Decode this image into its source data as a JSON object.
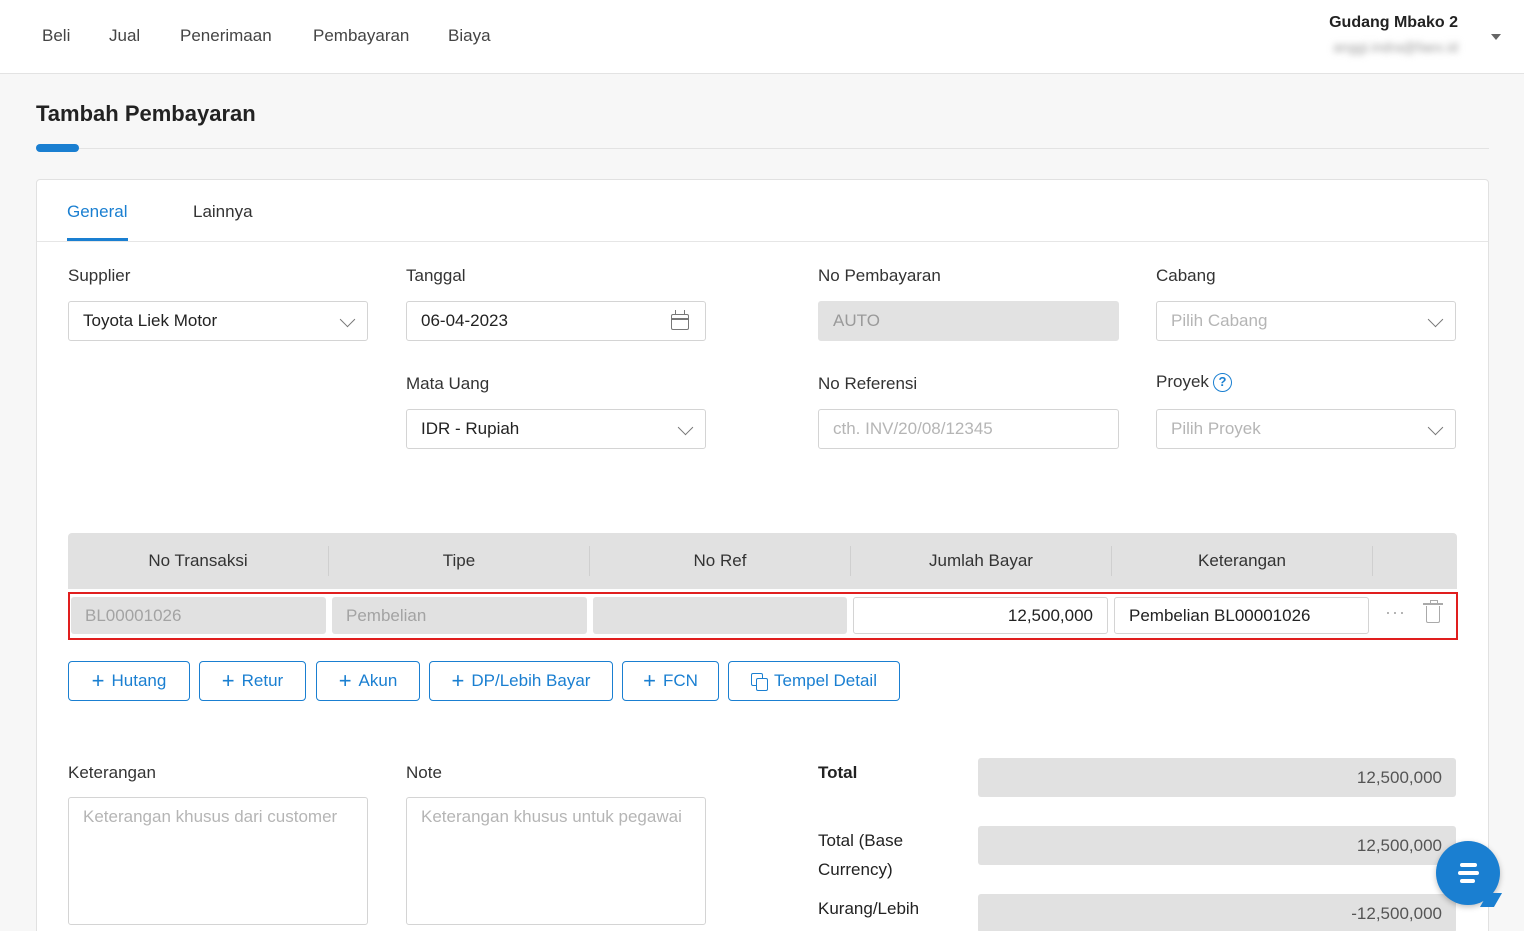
{
  "nav": [
    "Beli",
    "Jual",
    "Penerimaan",
    "Pembayaran",
    "Biaya"
  ],
  "user": {
    "name": "Gudang Mbako 2",
    "email": "anggi.indra@faex.id"
  },
  "page_title": "Tambah Pembayaran",
  "tabs": [
    "General",
    "Lainnya"
  ],
  "form": {
    "supplier_label": "Supplier",
    "supplier_value": "Toyota Liek Motor",
    "tanggal_label": "Tanggal",
    "tanggal_value": "06-04-2023",
    "no_pembayaran_label": "No Pembayaran",
    "no_pembayaran_value": "AUTO",
    "cabang_label": "Cabang",
    "cabang_placeholder": "Pilih Cabang",
    "mata_uang_label": "Mata Uang",
    "mata_uang_value": "IDR - Rupiah",
    "no_referensi_label": "No Referensi",
    "no_referensi_placeholder": "cth. INV/20/08/12345",
    "proyek_label": "Proyek",
    "proyek_help": "?",
    "proyek_placeholder": "Pilih Proyek"
  },
  "table": {
    "headers": [
      "No Transaksi",
      "Tipe",
      "No Ref",
      "Jumlah Bayar",
      "Keterangan"
    ],
    "row": {
      "no_transaksi": "BL00001026",
      "tipe": "Pembelian",
      "no_ref": "",
      "jumlah_bayar": "12,500,000",
      "keterangan": "Pembelian BL00001026",
      "more": "···"
    }
  },
  "buttons": {
    "hutang": "Hutang",
    "retur": "Retur",
    "akun": "Akun",
    "dp": "DP/Lebih Bayar",
    "fcn": "FCN",
    "tempel": "Tempel Detail",
    "plus": "+"
  },
  "notes": {
    "keterangan_label": "Keterangan",
    "keterangan_placeholder": "Keterangan khusus dari customer",
    "note_label": "Note",
    "note_placeholder": "Keterangan khusus untuk pegawai"
  },
  "summary": {
    "total_label": "Total",
    "total_value": "12,500,000",
    "base_label_1": "Total (Base",
    "base_label_2": "Currency)",
    "base_value": "12,500,000",
    "kurang_label": "Kurang/Lebih",
    "kurang_value": "-12,500,000"
  },
  "icons": [
    "chevron-down-icon",
    "calendar-icon",
    "help-icon",
    "trash-icon",
    "more-icon",
    "copy-icon",
    "chat-icon"
  ]
}
